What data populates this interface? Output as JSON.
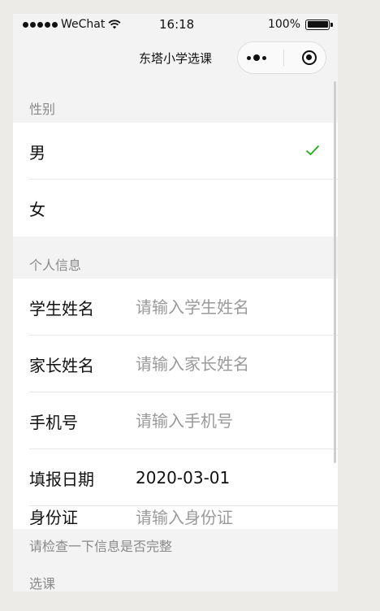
{
  "status_bar": {
    "carrier": "WeChat",
    "time": "16:18",
    "battery": "100%"
  },
  "nav": {
    "title": "东塔小学选课",
    "more_icon": "more-dots-icon",
    "close_icon": "target-icon"
  },
  "gender_section": {
    "header": "性别",
    "options": [
      {
        "label": "男",
        "selected": true
      },
      {
        "label": "女",
        "selected": false
      }
    ],
    "check_color": "#1aad19"
  },
  "info_section": {
    "header": "个人信息",
    "student_name": {
      "label": "学生姓名",
      "placeholder": "请输入学生姓名"
    },
    "parent_name": {
      "label": "家长姓名",
      "placeholder": "请输入家长姓名"
    },
    "phone": {
      "label": "手机号",
      "placeholder": "请输入手机号"
    },
    "date": {
      "label": "填报日期",
      "value": "2020-03-01"
    },
    "id_card": {
      "label": "身份证",
      "placeholder": "请输入身份证"
    }
  },
  "tip": "请检查一下信息是否完整",
  "course_section": {
    "header": "选课"
  }
}
